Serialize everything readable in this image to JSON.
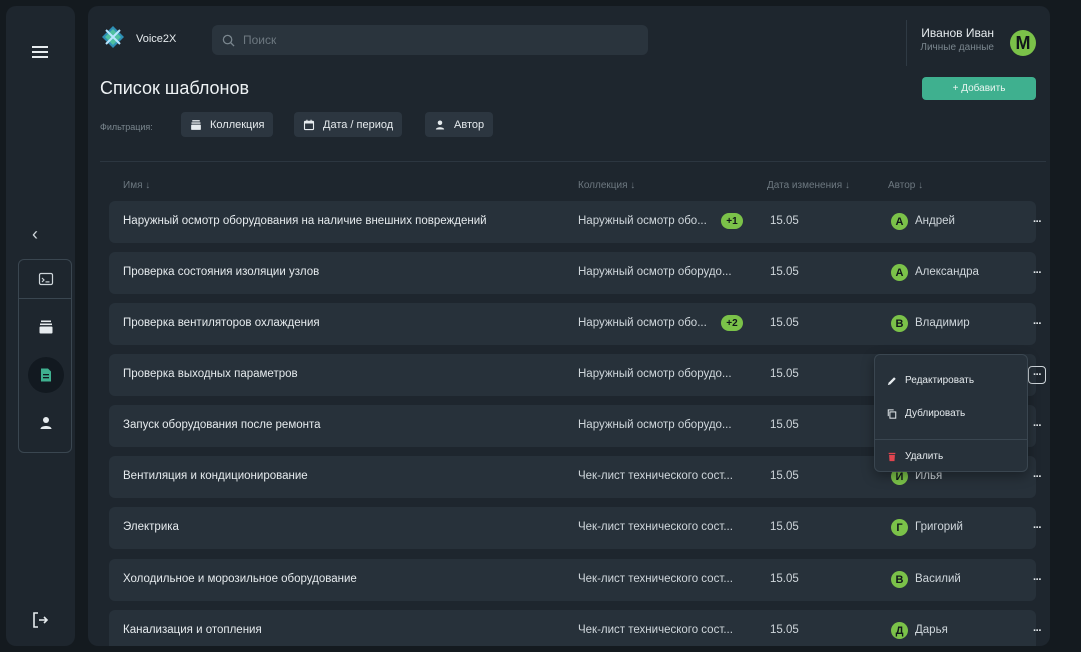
{
  "app": {
    "brand": "Voice2X"
  },
  "search": {
    "placeholder": "Поиск"
  },
  "user": {
    "name": "Иванов Иван",
    "subtitle": "Личные данные",
    "initial": "M"
  },
  "page": {
    "title": "Список шаблонов",
    "add_label": "+ Добавить"
  },
  "filters": {
    "label": "Фильтрация:",
    "chips": [
      {
        "label": "Коллекция",
        "icon": "stack-icon"
      },
      {
        "label": "Дата / период",
        "icon": "calendar-icon"
      },
      {
        "label": "Автор",
        "icon": "person-icon"
      }
    ]
  },
  "columns": {
    "name": "Имя ↓",
    "collection": "Коллекция ↓",
    "date": "Дата изменения ↓",
    "author": "Автор ↓"
  },
  "rows": [
    {
      "name": "Наружный осмотр оборудования на наличие внешних повреждений",
      "collection": "Наружный осмотр обо...",
      "extra": "+1",
      "date": "15.05",
      "author_initial": "А",
      "author": "Андрей",
      "more": "···"
    },
    {
      "name": "Проверка состояния изоляции узлов",
      "collection": "Наружный осмотр оборудо...",
      "extra": "",
      "date": "15.05",
      "author_initial": "А",
      "author": "Александра",
      "more": "···"
    },
    {
      "name": "Проверка вентиляторов охлаждения",
      "collection": "Наружный осмотр обо...",
      "extra": "+2",
      "date": "15.05",
      "author_initial": "В",
      "author": "Владимир",
      "more": "···"
    },
    {
      "name": "Проверка выходных параметров",
      "collection": "Наружный осмотр оборудо...",
      "extra": "",
      "date": "15.05",
      "author_initial": "",
      "author": "",
      "more": "···"
    },
    {
      "name": "Запуск оборудования после ремонта",
      "collection": "Наружный осмотр оборудо...",
      "extra": "",
      "date": "15.05",
      "author_initial": "",
      "author": "",
      "more": "···"
    },
    {
      "name": "Вентиляция и кондиционирование",
      "collection": "Чек-лист технического сост...",
      "extra": "",
      "date": "15.05",
      "author_initial": "И",
      "author": "Илья",
      "more": "···"
    },
    {
      "name": "Электрика",
      "collection": "Чек-лист технического сост...",
      "extra": "",
      "date": "15.05",
      "author_initial": "Г",
      "author": "Григорий",
      "more": "···"
    },
    {
      "name": "Холодильное и морозильное оборудование",
      "collection": "Чек-лист технического сост...",
      "extra": "",
      "date": "15.05",
      "author_initial": "В",
      "author": "Василий",
      "more": "···"
    },
    {
      "name": "Канализация и отопления",
      "collection": "Чек-лист технического сост...",
      "extra": "",
      "date": "15.05",
      "author_initial": "Д",
      "author": "Дарья",
      "more": "···"
    }
  ],
  "context_menu": {
    "edit": "Редактировать",
    "duplicate": "Дублировать",
    "delete": "Удалить"
  },
  "colors": {
    "accent": "#3fb08f",
    "avatar": "#7bc249",
    "danger": "#e0454f"
  }
}
